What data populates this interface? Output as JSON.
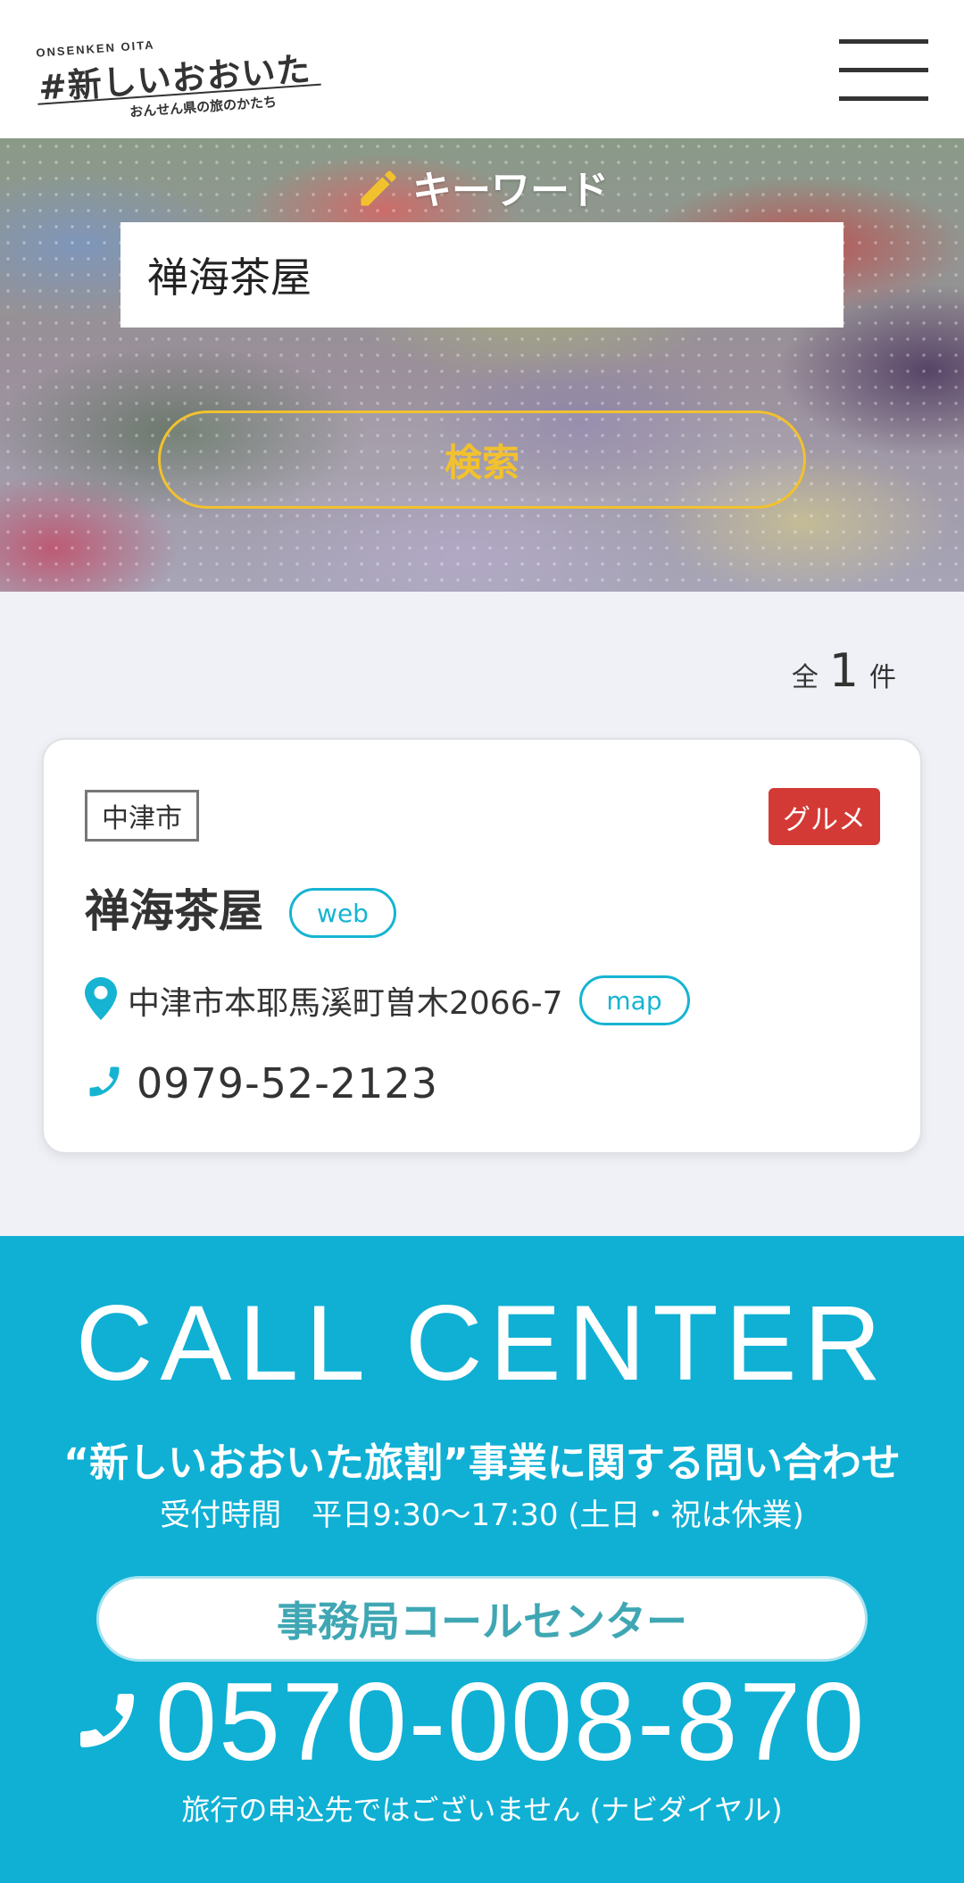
{
  "header": {
    "logo": {
      "top_text": "ONSENKEN OITA",
      "main_text": "#新しいおおいた",
      "sub_text": "おんせん県の旅のかたち"
    },
    "menu_icon": "hamburger-menu-icon"
  },
  "search": {
    "label": "キーワード",
    "label_icon": "pencil-icon",
    "input_value": "禅海茶屋",
    "button_label": "検索",
    "accent_color": "#f2c12e"
  },
  "results": {
    "count_prefix": "全",
    "count": "1",
    "count_suffix": "件",
    "items": [
      {
        "area": "中津市",
        "category": "グルメ",
        "category_color": "#d33a35",
        "name": "禅海茶屋",
        "web_label": "web",
        "address": "中津市本耶馬溪町曽木2066-7",
        "map_label": "map",
        "phone": "0979-52-2123"
      }
    ]
  },
  "call_center": {
    "title": "CALL CENTER",
    "subtitle": "“新しいおおいた旅割”事業に関する問い合わせ",
    "hours": "受付時間　平日9:30～17:30 (土日・祝は休業)",
    "button_label": "事務局コールセンター",
    "phone": "0570-008-870",
    "note": "旅行の申込先ではございません (ナビダイヤル)",
    "background_color": "#0fb0d4"
  }
}
